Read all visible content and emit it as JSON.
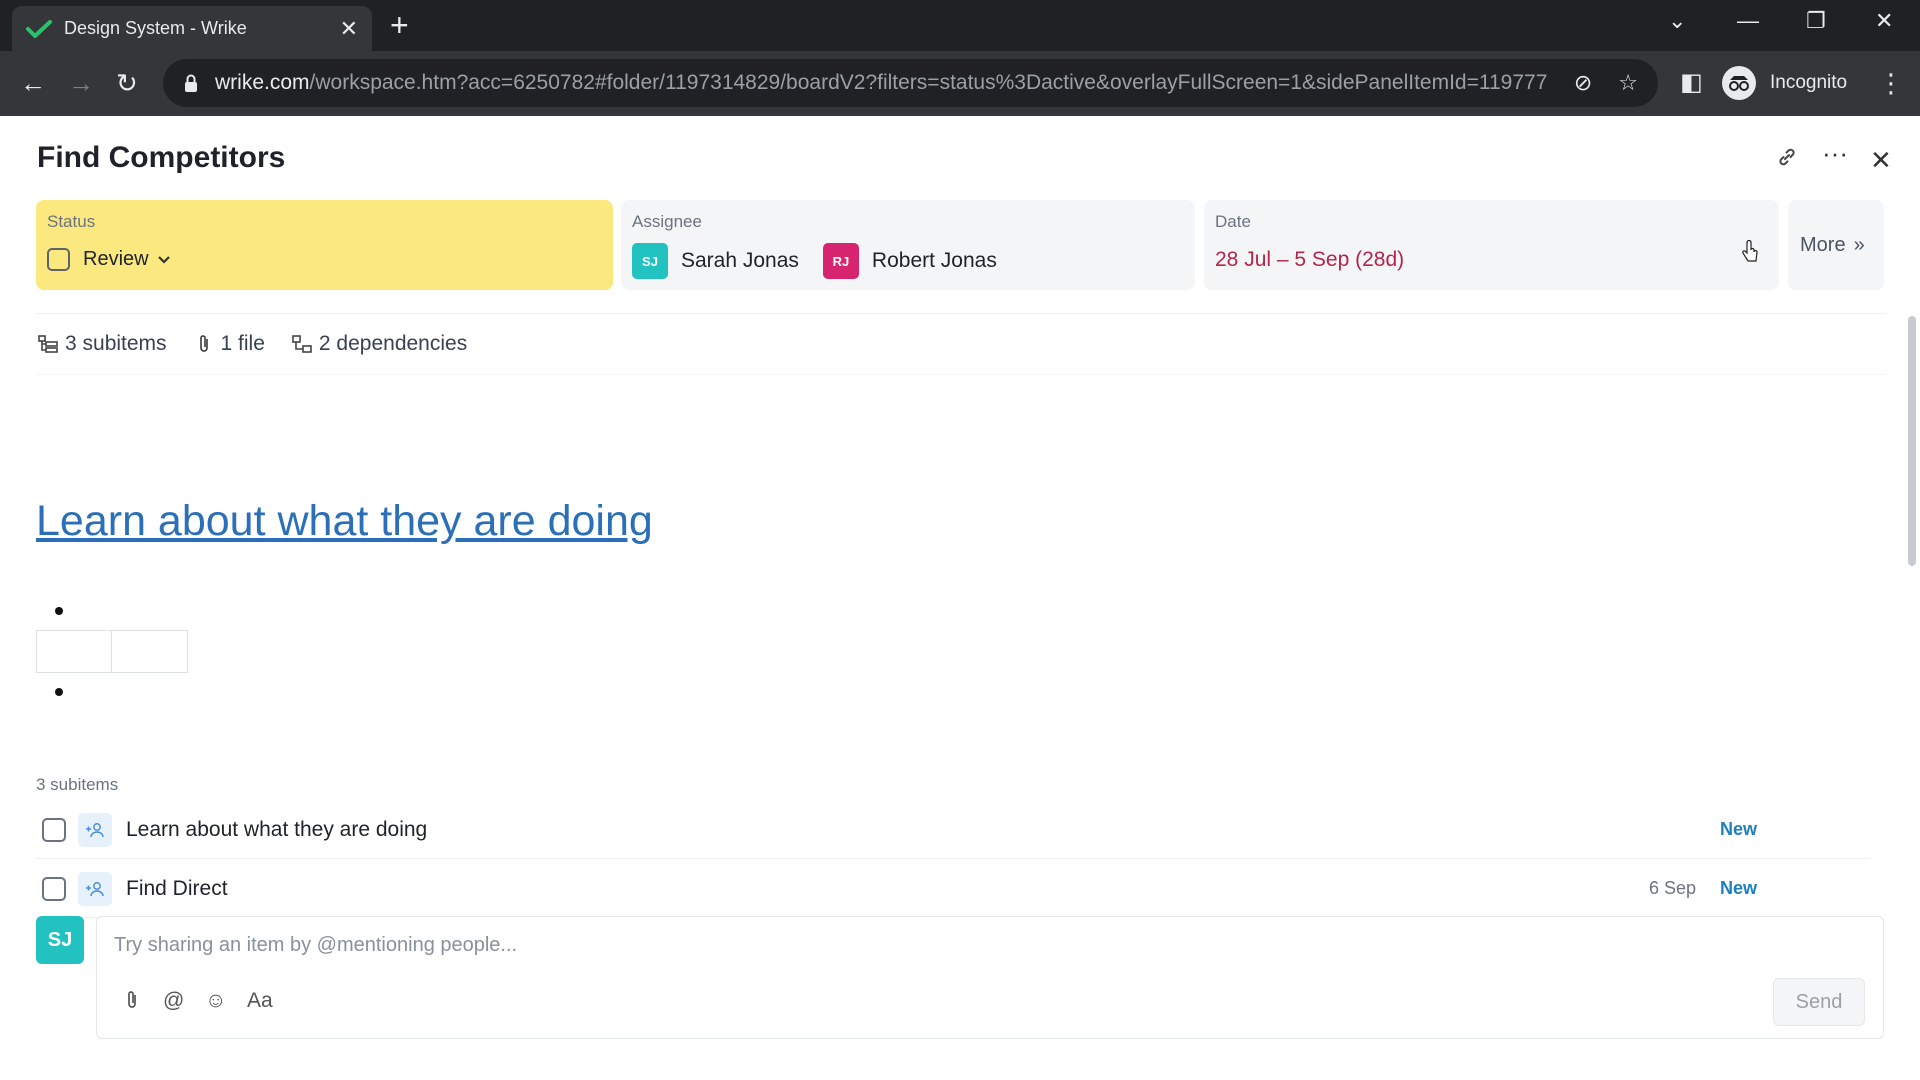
{
  "browser": {
    "tab_title": "Design System - Wrike",
    "url_host": "wrike.com",
    "url_path": "/workspace.htm?acc=6250782#folder/1197314829/boardV2?filters=status%3Dactive&overlayFullScreen=1&sidePanelItemId=119777...",
    "profile_label": "Incognito"
  },
  "task": {
    "title": "Find Competitors",
    "status": {
      "label": "Status",
      "value": "Review",
      "color": "#fbe97f"
    },
    "assignee": {
      "label": "Assignee",
      "people": [
        {
          "initials": "SJ",
          "name": "Sarah Jonas",
          "color": "#22c2c0"
        },
        {
          "initials": "RJ",
          "name": "Robert Jonas",
          "color": "#d6246e"
        }
      ]
    },
    "date": {
      "label": "Date",
      "value": "28 Jul – 5 Sep (28d)"
    },
    "more_label": "More",
    "meta": {
      "subitems": "3 subitems",
      "files": "1 file",
      "dependencies": "2 dependencies"
    },
    "description_link": "Learn about what they are doing",
    "subitems_heading": "3 subitems",
    "subitems": [
      {
        "title": "Learn about what they are doing",
        "date": "",
        "status": "New"
      },
      {
        "title": "Find Direct",
        "date": "6 Sep",
        "status": "New"
      }
    ]
  },
  "composer": {
    "avatar_initials": "SJ",
    "placeholder": "Try sharing an item by @mentioning people...",
    "format_label": "Aa",
    "send_label": "Send"
  }
}
